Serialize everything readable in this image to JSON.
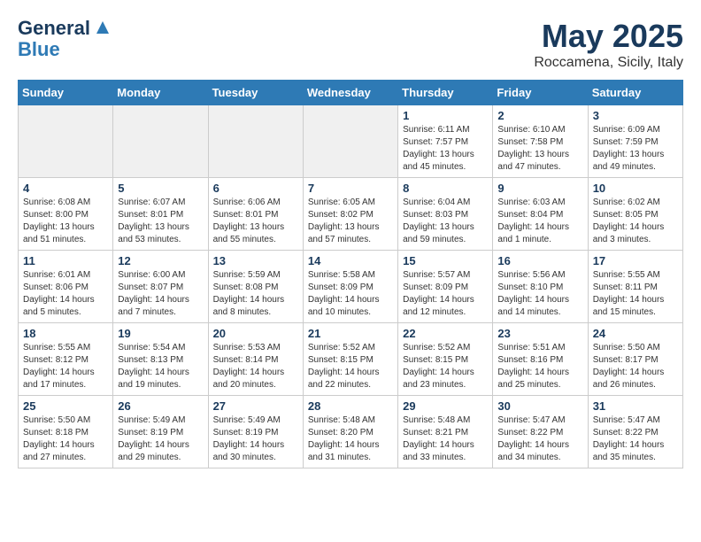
{
  "header": {
    "logo_line1": "General",
    "logo_line2": "Blue",
    "month": "May 2025",
    "location": "Roccamena, Sicily, Italy"
  },
  "days_of_week": [
    "Sunday",
    "Monday",
    "Tuesday",
    "Wednesday",
    "Thursday",
    "Friday",
    "Saturday"
  ],
  "weeks": [
    [
      {
        "day": "",
        "info": "",
        "empty": true
      },
      {
        "day": "",
        "info": "",
        "empty": true
      },
      {
        "day": "",
        "info": "",
        "empty": true
      },
      {
        "day": "",
        "info": "",
        "empty": true
      },
      {
        "day": "1",
        "info": "Sunrise: 6:11 AM\nSunset: 7:57 PM\nDaylight: 13 hours\nand 45 minutes."
      },
      {
        "day": "2",
        "info": "Sunrise: 6:10 AM\nSunset: 7:58 PM\nDaylight: 13 hours\nand 47 minutes."
      },
      {
        "day": "3",
        "info": "Sunrise: 6:09 AM\nSunset: 7:59 PM\nDaylight: 13 hours\nand 49 minutes."
      }
    ],
    [
      {
        "day": "4",
        "info": "Sunrise: 6:08 AM\nSunset: 8:00 PM\nDaylight: 13 hours\nand 51 minutes."
      },
      {
        "day": "5",
        "info": "Sunrise: 6:07 AM\nSunset: 8:01 PM\nDaylight: 13 hours\nand 53 minutes."
      },
      {
        "day": "6",
        "info": "Sunrise: 6:06 AM\nSunset: 8:01 PM\nDaylight: 13 hours\nand 55 minutes."
      },
      {
        "day": "7",
        "info": "Sunrise: 6:05 AM\nSunset: 8:02 PM\nDaylight: 13 hours\nand 57 minutes."
      },
      {
        "day": "8",
        "info": "Sunrise: 6:04 AM\nSunset: 8:03 PM\nDaylight: 13 hours\nand 59 minutes."
      },
      {
        "day": "9",
        "info": "Sunrise: 6:03 AM\nSunset: 8:04 PM\nDaylight: 14 hours\nand 1 minute."
      },
      {
        "day": "10",
        "info": "Sunrise: 6:02 AM\nSunset: 8:05 PM\nDaylight: 14 hours\nand 3 minutes."
      }
    ],
    [
      {
        "day": "11",
        "info": "Sunrise: 6:01 AM\nSunset: 8:06 PM\nDaylight: 14 hours\nand 5 minutes."
      },
      {
        "day": "12",
        "info": "Sunrise: 6:00 AM\nSunset: 8:07 PM\nDaylight: 14 hours\nand 7 minutes."
      },
      {
        "day": "13",
        "info": "Sunrise: 5:59 AM\nSunset: 8:08 PM\nDaylight: 14 hours\nand 8 minutes."
      },
      {
        "day": "14",
        "info": "Sunrise: 5:58 AM\nSunset: 8:09 PM\nDaylight: 14 hours\nand 10 minutes."
      },
      {
        "day": "15",
        "info": "Sunrise: 5:57 AM\nSunset: 8:09 PM\nDaylight: 14 hours\nand 12 minutes."
      },
      {
        "day": "16",
        "info": "Sunrise: 5:56 AM\nSunset: 8:10 PM\nDaylight: 14 hours\nand 14 minutes."
      },
      {
        "day": "17",
        "info": "Sunrise: 5:55 AM\nSunset: 8:11 PM\nDaylight: 14 hours\nand 15 minutes."
      }
    ],
    [
      {
        "day": "18",
        "info": "Sunrise: 5:55 AM\nSunset: 8:12 PM\nDaylight: 14 hours\nand 17 minutes."
      },
      {
        "day": "19",
        "info": "Sunrise: 5:54 AM\nSunset: 8:13 PM\nDaylight: 14 hours\nand 19 minutes."
      },
      {
        "day": "20",
        "info": "Sunrise: 5:53 AM\nSunset: 8:14 PM\nDaylight: 14 hours\nand 20 minutes."
      },
      {
        "day": "21",
        "info": "Sunrise: 5:52 AM\nSunset: 8:15 PM\nDaylight: 14 hours\nand 22 minutes."
      },
      {
        "day": "22",
        "info": "Sunrise: 5:52 AM\nSunset: 8:15 PM\nDaylight: 14 hours\nand 23 minutes."
      },
      {
        "day": "23",
        "info": "Sunrise: 5:51 AM\nSunset: 8:16 PM\nDaylight: 14 hours\nand 25 minutes."
      },
      {
        "day": "24",
        "info": "Sunrise: 5:50 AM\nSunset: 8:17 PM\nDaylight: 14 hours\nand 26 minutes."
      }
    ],
    [
      {
        "day": "25",
        "info": "Sunrise: 5:50 AM\nSunset: 8:18 PM\nDaylight: 14 hours\nand 27 minutes."
      },
      {
        "day": "26",
        "info": "Sunrise: 5:49 AM\nSunset: 8:19 PM\nDaylight: 14 hours\nand 29 minutes."
      },
      {
        "day": "27",
        "info": "Sunrise: 5:49 AM\nSunset: 8:19 PM\nDaylight: 14 hours\nand 30 minutes."
      },
      {
        "day": "28",
        "info": "Sunrise: 5:48 AM\nSunset: 8:20 PM\nDaylight: 14 hours\nand 31 minutes."
      },
      {
        "day": "29",
        "info": "Sunrise: 5:48 AM\nSunset: 8:21 PM\nDaylight: 14 hours\nand 33 minutes."
      },
      {
        "day": "30",
        "info": "Sunrise: 5:47 AM\nSunset: 8:22 PM\nDaylight: 14 hours\nand 34 minutes."
      },
      {
        "day": "31",
        "info": "Sunrise: 5:47 AM\nSunset: 8:22 PM\nDaylight: 14 hours\nand 35 minutes."
      }
    ]
  ]
}
